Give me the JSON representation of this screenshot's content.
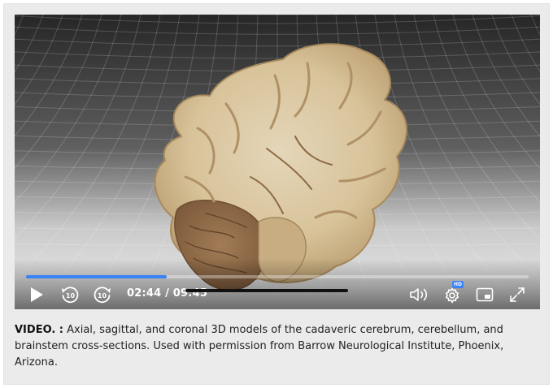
{
  "player": {
    "current_time": "02:44",
    "time_separator": " / ",
    "duration": "09:45",
    "progress": 0.28,
    "hd_badge": "HD",
    "icons": {
      "play": "play-icon",
      "rewind": "rewind-10-icon",
      "forward": "forward-10-icon",
      "volume": "volume-icon",
      "settings": "gear-icon",
      "pip": "picture-in-picture-icon",
      "fullscreen": "fullscreen-icon"
    },
    "skip_seconds": "10",
    "accent_color": "#3b82f6"
  },
  "caption": {
    "label": "VIDEO. :",
    "text": " Axial, sagittal, and coronal 3D models of the cadaveric cerebrum, cerebellum, and brainstem cross-sections. Used with permission from Barrow Neurological Institute, Phoenix, Arizona."
  }
}
